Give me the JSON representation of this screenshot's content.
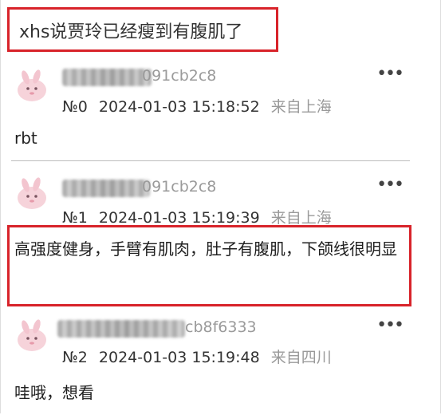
{
  "header": {
    "title": "xhs说贾玲已经瘦到有腹肌了"
  },
  "posts": [
    {
      "user_id": "091cb2c8",
      "floor": "№0",
      "timestamp": "2024-01-03 15:18:52",
      "location": "来自上海",
      "content": "rbt",
      "more": "•••"
    },
    {
      "user_id": "091cb2c8",
      "floor": "№1",
      "timestamp": "2024-01-03 15:19:39",
      "location": "来自上海",
      "content": "高强度健身，手臂有肌肉，肚子有腹肌，下颌线很明显",
      "more": "•••"
    },
    {
      "user_id": "cb8f6333",
      "floor": "№2",
      "timestamp": "2024-01-03 15:19:48",
      "location": "来自四川",
      "content": "哇哦，想看",
      "more": "•••"
    }
  ],
  "colors": {
    "highlight_border": "#d8232a",
    "secondary_text": "#9a9a9a"
  }
}
